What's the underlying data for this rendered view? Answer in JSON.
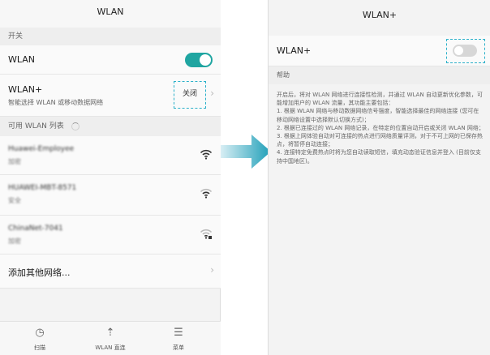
{
  "left_screen": {
    "title": "WLAN",
    "section_switch": "开关",
    "wlan_row": {
      "label": "WLAN",
      "toggle_state": "on"
    },
    "wlanplus_row": {
      "label": "WLAN+",
      "subtitle": "智能选择 WLAN 或移动数据网络",
      "value": "关闭",
      "chevron": "›"
    },
    "section_networks": "可用 WLAN 列表",
    "networks": [
      {
        "name": "Huawei-Employee",
        "security": "加密",
        "icon": "wifi-icon"
      },
      {
        "name": "HUAWEI-MBT-8571",
        "security": "安全",
        "icon": "wifi-icon"
      },
      {
        "name": "ChinaNet-7041",
        "security": "加密",
        "icon": "wifi-locked-icon"
      }
    ],
    "add_network": {
      "label": "添加其他网络...",
      "chevron": "›"
    },
    "bottom_nav": [
      {
        "label": "扫描",
        "glyph": "◷",
        "icon": "scan-icon"
      },
      {
        "label": "WLAN 直连",
        "glyph": "⇡",
        "icon": "wlan-direct-icon"
      },
      {
        "label": "菜单",
        "glyph": "☰",
        "icon": "menu-icon"
      }
    ],
    "accent_color": "#1fa5a1"
  },
  "right_screen": {
    "title": "WLAN+",
    "wlanplus_row": {
      "label": "WLAN+",
      "toggle_state": "off"
    },
    "help_header": "帮助",
    "help_lines": [
      "开启后，将对 WLAN 网络进行连接性检测，并通过 WLAN 自动更新优化参数，可能增加用户的 WLAN 流量，其功能主要包括：",
      "1. 根据 WLAN 网络与移动数据网络信号强度，智能选择最佳的网络连接 (您可在移动网络设置中选择默认切换方式)；",
      "2. 根据已连接过的 WLAN 网络记录，在特定的位置自动开启或关闭 WLAN 网络；",
      "3. 根据上网体验自动对可连接的热点进行网络质量评测，对于不可上网的已保存热点，将暂停自动连接；",
      "4. 连接特定免费热点时将为您自动读取短信，填充动态验证信息并登入 (目前仅支持中国地区)。"
    ]
  },
  "arrow_color": "#1f9fb8",
  "highlight_color": "#2bb0c9"
}
